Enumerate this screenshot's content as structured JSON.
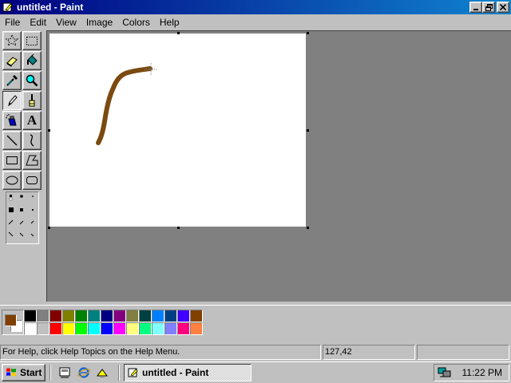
{
  "window": {
    "title": "untitled - Paint",
    "buttons": {
      "minimize": "_",
      "maximize": "❐",
      "close": "✕"
    }
  },
  "menu": [
    "File",
    "Edit",
    "View",
    "Image",
    "Colors",
    "Help"
  ],
  "toolbox": {
    "tools": [
      {
        "name": "free-form-select",
        "icon": "star-select-icon"
      },
      {
        "name": "select",
        "icon": "rect-select-icon"
      },
      {
        "name": "eraser",
        "icon": "eraser-icon"
      },
      {
        "name": "fill-with-color",
        "icon": "fill-bucket-icon"
      },
      {
        "name": "pick-color",
        "icon": "eyedropper-icon"
      },
      {
        "name": "magnifier",
        "icon": "magnifier-icon"
      },
      {
        "name": "pencil",
        "icon": "pencil-icon"
      },
      {
        "name": "brush",
        "icon": "brush-icon"
      },
      {
        "name": "airbrush",
        "icon": "airbrush-icon"
      },
      {
        "name": "text",
        "icon": "text-icon",
        "glyph": "A"
      },
      {
        "name": "line",
        "icon": "line-icon"
      },
      {
        "name": "curve",
        "icon": "curve-icon"
      },
      {
        "name": "rectangle",
        "icon": "rectangle-icon"
      },
      {
        "name": "polygon",
        "icon": "polygon-icon"
      },
      {
        "name": "ellipse",
        "icon": "ellipse-icon"
      },
      {
        "name": "rounded-rectangle",
        "icon": "rounded-rectangle-icon"
      }
    ],
    "selected_tool": "pencil"
  },
  "colors": {
    "foreground": "#804000",
    "background": "#ffffff",
    "palette_top": [
      "#000000",
      "#808080",
      "#800000",
      "#808000",
      "#008000",
      "#008080",
      "#000080",
      "#800080",
      "#808040",
      "#004040",
      "#0080ff",
      "#004080",
      "#4000ff",
      "#804000"
    ],
    "palette_bottom": [
      "#ffffff",
      "#c0c0c0",
      "#ff0000",
      "#ffff00",
      "#00ff00",
      "#00ffff",
      "#0000ff",
      "#ff00ff",
      "#ffff80",
      "#00ff80",
      "#80ffff",
      "#8080ff",
      "#ff0080",
      "#ff8040"
    ],
    "stroke_color": "#7a4a10"
  },
  "status": {
    "help_text": "For Help, click Help Topics on the Help Menu.",
    "coordinates": "127,42",
    "size": ""
  },
  "taskbar": {
    "start_label": "Start",
    "task_label": "untitled - Paint",
    "clock": "11:22 PM",
    "quick_launch": [
      "show-desktop-icon",
      "internet-explorer-icon",
      "channels-icon"
    ]
  }
}
